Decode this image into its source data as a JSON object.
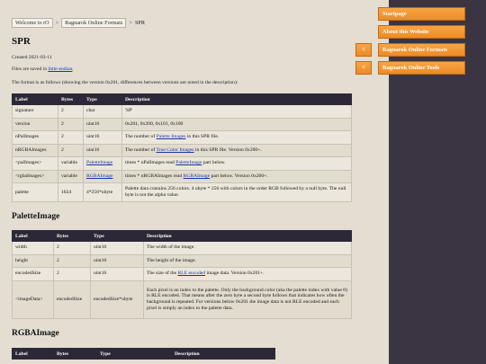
{
  "breadcrumb": {
    "home": "Welcome to rO",
    "sep1": ">",
    "parent": "Ragnarok Online Formats",
    "sep2": ">",
    "current": "SPR"
  },
  "nav": {
    "startpage": "Startpage",
    "about": "About this Website",
    "formats": "Ragnarok Online Formats",
    "tools": "Ragnarok Online Tools",
    "back_icon": "<"
  },
  "page": {
    "title": "SPR",
    "created": "Created 2021-03-11",
    "files_prefix": "Files are saved in ",
    "files_link": "little-endian",
    "files_suffix": ".",
    "format_note": "The format is as follows (showing the version 0x201, differences between versions are noted in the description):"
  },
  "main_table": {
    "headers": [
      "Label",
      "Bytes",
      "Type",
      "Description"
    ],
    "rows": [
      {
        "label": "signature",
        "bytes": "2",
        "type": "char",
        "desc": "'SP'"
      },
      {
        "label": "version",
        "bytes": "2",
        "type": "uint16",
        "desc": "0x201, 0x200, 0x101, 0x100"
      },
      {
        "label": "nPalImages",
        "bytes": "2",
        "type": "uint16",
        "desc_a": "The number of ",
        "desc_link": "Palette Images",
        "desc_b": " in this SPR file."
      },
      {
        "label": "nRGBAImages",
        "bytes": "2",
        "type": "uint16",
        "desc_a": "The number of ",
        "desc_link": "True Color Images",
        "desc_b": " in this SPR file. Version 0x200+."
      },
      {
        "label": "<palImages>",
        "bytes": "variable",
        "type": "PaletteImage",
        "desc_a": "times * nPalImages read ",
        "desc_link": "PaletteImage",
        "desc_b": " part below."
      },
      {
        "label": "<rgbaImages>",
        "bytes": "variable",
        "type": "RGBAImage",
        "desc_a": "times * nRGBAImages read ",
        "desc_link": "RGBAImage",
        "desc_b": " part below. Version 0x200+."
      },
      {
        "label": "palette",
        "bytes": "1024",
        "type": "4*256*ubyte",
        "desc": "Palette data contains 256 colors. 4 ubyte * 256 with colors in the order RGB followed by a null byte. The null byte is not the alpha value."
      }
    ]
  },
  "palette_section": {
    "title": "PaletteImage",
    "headers": [
      "Label",
      "Bytes",
      "Type",
      "Description"
    ],
    "rows": [
      {
        "label": "width",
        "bytes": "2",
        "type": "uint16",
        "desc": "The width of the image."
      },
      {
        "label": "height",
        "bytes": "2",
        "type": "uint16",
        "desc": "The height of the image."
      },
      {
        "label": "encodedSize",
        "bytes": "2",
        "type": "uint16",
        "desc_a": "The size of the ",
        "desc_link": "RLE encoded",
        "desc_b": " image data. Version 0x201+."
      },
      {
        "label": "<imageData>",
        "bytes": "encodedSize",
        "type": "encodedSize*ubyte",
        "desc": "Each pixel is an index to the palette. Only the background color (aka the palette index with value 0) is RLE encoded. That means after the zero byte a second byte follows that indicates how often the background is repeated. For versions below 0x201 the image data is not RLE encoded and each pixel is simply an index to the palette data."
      }
    ]
  },
  "rgba_section": {
    "title": "RGBAImage",
    "headers": [
      "Label",
      "Bytes",
      "Type",
      "Description"
    ]
  }
}
